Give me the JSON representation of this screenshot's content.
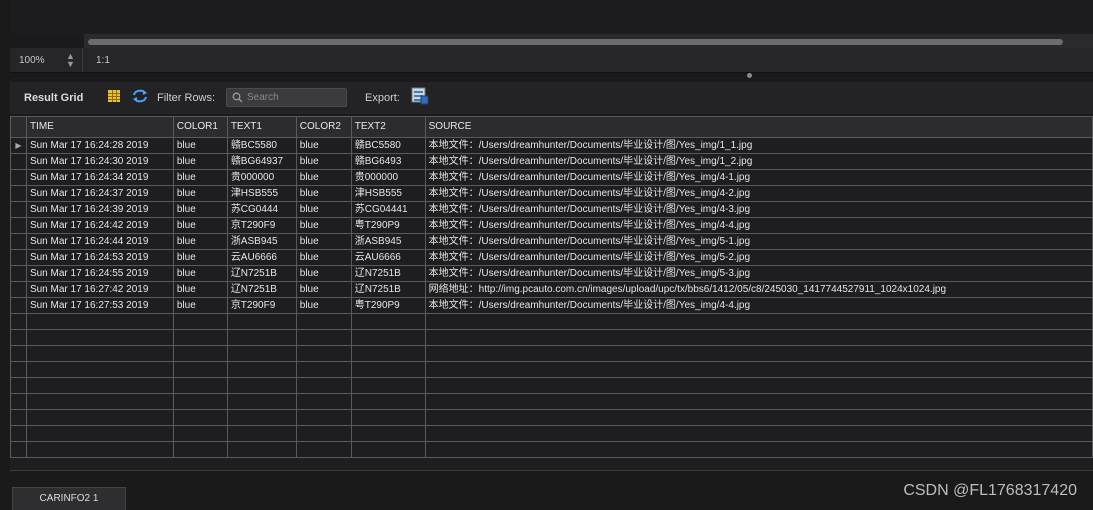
{
  "zoom": {
    "level": "100%",
    "ratio": "1:1"
  },
  "toolbar": {
    "title": "Result Grid",
    "filter_label": "Filter Rows:",
    "search_placeholder": "Search",
    "export_label": "Export:"
  },
  "grid": {
    "columns": [
      "TIME",
      "COLOR1",
      "TEXT1",
      "COLOR2",
      "TEXT2",
      "SOURCE"
    ],
    "current_row_marker": "▶",
    "rows": [
      [
        "Sun Mar 17 16:24:28 2019",
        "blue",
        "赣BC5580",
        "blue",
        "赣BC5580",
        "本地文件：/Users/dreamhunter/Documents/毕业设计/图/Yes_img/1_1.jpg"
      ],
      [
        "Sun Mar 17 16:24:30 2019",
        "blue",
        "赣BG64937",
        "blue",
        "赣BG6493",
        "本地文件：/Users/dreamhunter/Documents/毕业设计/图/Yes_img/1_2.jpg"
      ],
      [
        "Sun Mar 17 16:24:34 2019",
        "blue",
        "贵000000",
        "blue",
        "贵000000",
        "本地文件：/Users/dreamhunter/Documents/毕业设计/图/Yes_img/4-1.jpg"
      ],
      [
        "Sun Mar 17 16:24:37 2019",
        "blue",
        "津HSB555",
        "blue",
        "津HSB555",
        "本地文件：/Users/dreamhunter/Documents/毕业设计/图/Yes_img/4-2.jpg"
      ],
      [
        "Sun Mar 17 16:24:39 2019",
        "blue",
        "苏CG0444",
        "blue",
        "苏CG04441",
        "本地文件：/Users/dreamhunter/Documents/毕业设计/图/Yes_img/4-3.jpg"
      ],
      [
        "Sun Mar 17 16:24:42 2019",
        "blue",
        "京T290F9",
        "blue",
        "粤T290P9",
        "本地文件：/Users/dreamhunter/Documents/毕业设计/图/Yes_img/4-4.jpg"
      ],
      [
        "Sun Mar 17 16:24:44 2019",
        "blue",
        "浙ASB945",
        "blue",
        "浙ASB945",
        "本地文件：/Users/dreamhunter/Documents/毕业设计/图/Yes_img/5-1.jpg"
      ],
      [
        "Sun Mar 17 16:24:53 2019",
        "blue",
        "云AU6666",
        "blue",
        "云AU6666",
        "本地文件：/Users/dreamhunter/Documents/毕业设计/图/Yes_img/5-2.jpg"
      ],
      [
        "Sun Mar 17 16:24:55 2019",
        "blue",
        "辽N7251B",
        "blue",
        "辽N7251B",
        "本地文件：/Users/dreamhunter/Documents/毕业设计/图/Yes_img/5-3.jpg"
      ],
      [
        "Sun Mar 17 16:27:42 2019",
        "blue",
        "辽N7251B",
        "blue",
        "辽N7251B",
        "网络地址：http://img.pcauto.com.cn/images/upload/upc/tx/bbs6/1412/05/c8/245030_1417744527911_1024x1024.jpg"
      ],
      [
        "Sun Mar 17 16:27:53 2019",
        "blue",
        "京T290F9",
        "blue",
        "粤T290P9",
        "本地文件：/Users/dreamhunter/Documents/毕业设计/图/Yes_img/4-4.jpg"
      ]
    ]
  },
  "tabs": {
    "active": "CARINFO2 1"
  },
  "watermark": "CSDN @FL1768317420"
}
